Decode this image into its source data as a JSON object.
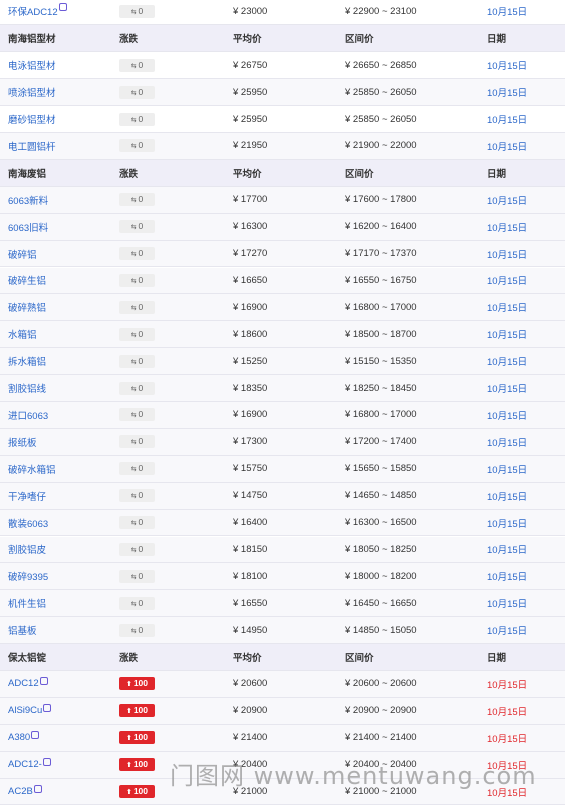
{
  "columns": {
    "change": "涨跌",
    "avg": "平均价",
    "range": "区间价",
    "date": "日期"
  },
  "groups": [
    {
      "header": null,
      "rows": [
        {
          "name": "环保ADC12",
          "tag": true,
          "change": "0",
          "dir": "flat",
          "avg": "¥ 23000",
          "range": "¥ 22900 ~ 23100",
          "date": "10月15日"
        }
      ]
    },
    {
      "header": "南海铝型材",
      "rows": [
        {
          "name": "电泳铝型材",
          "change": "0",
          "dir": "flat",
          "avg": "¥ 26750",
          "range": "¥ 26650 ~ 26850",
          "date": "10月15日"
        },
        {
          "name": "喷涂铝型材",
          "change": "0",
          "dir": "flat",
          "avg": "¥ 25950",
          "range": "¥ 25850 ~ 26050",
          "date": "10月15日"
        },
        {
          "name": "磨砂铝型材",
          "change": "0",
          "dir": "flat",
          "avg": "¥ 25950",
          "range": "¥ 25850 ~ 26050",
          "date": "10月15日"
        },
        {
          "name": "电工圆铝杆",
          "change": "0",
          "dir": "flat",
          "avg": "¥ 21950",
          "range": "¥ 21900 ~ 22000",
          "date": "10月15日"
        }
      ]
    },
    {
      "header": "南海废铝",
      "rows": [
        {
          "name": "6063新料",
          "change": "0",
          "dir": "flat",
          "avg": "¥ 17700",
          "range": "¥ 17600 ~ 17800",
          "date": "10月15日"
        },
        {
          "name": "6063旧料",
          "change": "0",
          "dir": "flat",
          "avg": "¥ 16300",
          "range": "¥ 16200 ~ 16400",
          "date": "10月15日"
        },
        {
          "name": "破碎铝",
          "change": "0",
          "dir": "flat",
          "avg": "¥ 17270",
          "range": "¥ 17170 ~ 17370",
          "date": "10月15日"
        },
        {
          "name": "破碎生铝",
          "change": "0",
          "dir": "flat",
          "avg": "¥ 16650",
          "range": "¥ 16550 ~ 16750",
          "date": "10月15日"
        },
        {
          "name": "破碎熟铝",
          "change": "0",
          "dir": "flat",
          "avg": "¥ 16900",
          "range": "¥ 16800 ~ 17000",
          "date": "10月15日"
        },
        {
          "name": "水箱铝",
          "change": "0",
          "dir": "flat",
          "avg": "¥ 18600",
          "range": "¥ 18500 ~ 18700",
          "date": "10月15日"
        },
        {
          "name": "拆水箱铝",
          "change": "0",
          "dir": "flat",
          "avg": "¥ 15250",
          "range": "¥ 15150 ~ 15350",
          "date": "10月15日"
        },
        {
          "name": "割胶铝线",
          "change": "0",
          "dir": "flat",
          "avg": "¥ 18350",
          "range": "¥ 18250 ~ 18450",
          "date": "10月15日"
        },
        {
          "name": "进口6063",
          "change": "0",
          "dir": "flat",
          "avg": "¥ 16900",
          "range": "¥ 16800 ~ 17000",
          "date": "10月15日"
        },
        {
          "name": "报纸板",
          "change": "0",
          "dir": "flat",
          "avg": "¥ 17300",
          "range": "¥ 17200 ~ 17400",
          "date": "10月15日"
        },
        {
          "name": "破碎水箱铝",
          "change": "0",
          "dir": "flat",
          "avg": "¥ 15750",
          "range": "¥ 15650 ~ 15850",
          "date": "10月15日"
        },
        {
          "name": "干净嗜仔",
          "change": "0",
          "dir": "flat",
          "avg": "¥ 14750",
          "range": "¥ 14650 ~ 14850",
          "date": "10月15日"
        },
        {
          "name": "散装6063",
          "change": "0",
          "dir": "flat",
          "avg": "¥ 16400",
          "range": "¥ 16300 ~ 16500",
          "date": "10月15日"
        },
        {
          "name": "割胶铝皮",
          "change": "0",
          "dir": "flat",
          "avg": "¥ 18150",
          "range": "¥ 18050 ~ 18250",
          "date": "10月15日"
        },
        {
          "name": "破碎9395",
          "change": "0",
          "dir": "flat",
          "avg": "¥ 18100",
          "range": "¥ 18000 ~ 18200",
          "date": "10月15日"
        },
        {
          "name": "机件生铝",
          "change": "0",
          "dir": "flat",
          "avg": "¥ 16550",
          "range": "¥ 16450 ~ 16650",
          "date": "10月15日"
        },
        {
          "name": "铝基板",
          "change": "0",
          "dir": "flat",
          "avg": "¥ 14950",
          "range": "¥ 14850 ~ 15050",
          "date": "10月15日"
        }
      ]
    },
    {
      "header": "保太铝锭",
      "rows": [
        {
          "name": "ADC12",
          "tag": true,
          "change": "100",
          "dir": "up",
          "avg": "¥ 20600",
          "range": "¥ 20600 ~ 20600",
          "date": "10月15日"
        },
        {
          "name": "AlSi9Cu",
          "tag": true,
          "change": "100",
          "dir": "up",
          "avg": "¥ 20900",
          "range": "¥ 20900 ~ 20900",
          "date": "10月15日"
        },
        {
          "name": "A380",
          "tag": true,
          "change": "100",
          "dir": "up",
          "avg": "¥ 21400",
          "range": "¥ 21400 ~ 21400",
          "date": "10月15日"
        },
        {
          "name": "ADC12-",
          "tag": true,
          "change": "100",
          "dir": "up",
          "avg": "¥ 20400",
          "range": "¥ 20400 ~ 20400",
          "date": "10月15日"
        },
        {
          "name": "AC2B",
          "tag": true,
          "change": "100",
          "dir": "up",
          "avg": "¥ 21000",
          "range": "¥ 21000 ~ 21000",
          "date": "10月15日"
        }
      ]
    }
  ],
  "icons": {
    "flat": "swap-icon",
    "up": "up-arrow-icon"
  },
  "colors": {
    "link": "#2b67c9",
    "up": "#e0262b",
    "header_bg": "#efeef8"
  },
  "watermark": "门图网 www.mentuwang.com"
}
